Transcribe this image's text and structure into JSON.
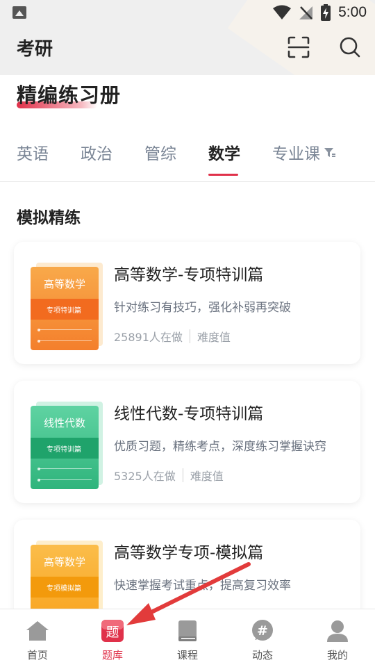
{
  "status_bar": {
    "time": "5:00"
  },
  "header": {
    "title": "考研"
  },
  "page_heading": "精编练习册",
  "tabs": [
    {
      "label": "英语",
      "active": false
    },
    {
      "label": "政治",
      "active": false
    },
    {
      "label": "管综",
      "active": false
    },
    {
      "label": "数学",
      "active": true
    },
    {
      "label": "专业课",
      "active": false
    }
  ],
  "section_title": "模拟精练",
  "cards": [
    {
      "title": "高等数学-专项特训篇",
      "description": "针对练习有技巧，强化补弱再突破",
      "participants": "25891人在做",
      "difficulty_label": "难度值",
      "cover_title": "高等数学",
      "cover_band": "专项特训篇",
      "theme": "#f7933a"
    },
    {
      "title": "线性代数-专项特训篇",
      "description": "优质习题，精练考点，深度练习掌握诀窍",
      "participants": "5325人在做",
      "difficulty_label": "难度值",
      "cover_title": "线性代数",
      "cover_band": "专项特训篇",
      "theme": "#36c08a"
    },
    {
      "title": "高等数学专项-模拟篇",
      "description": "快速掌握考试重点，提高复习效率",
      "participants": "",
      "difficulty_label": "",
      "cover_title": "高等数学",
      "cover_band": "专项模拟篇",
      "theme": "#f9a826"
    }
  ],
  "bottom_nav": [
    {
      "label": "首页",
      "icon": "home-icon",
      "active": false
    },
    {
      "label": "题库",
      "icon": "question-bank-icon",
      "glyph": "题",
      "active": true
    },
    {
      "label": "课程",
      "icon": "book-icon",
      "active": false
    },
    {
      "label": "动态",
      "icon": "hashtag-icon",
      "glyph": "#",
      "active": false
    },
    {
      "label": "我的",
      "icon": "profile-icon",
      "active": false
    }
  ],
  "colors": {
    "accent": "#e0314a",
    "orange": "#f7933a",
    "green": "#36c08a",
    "annotation": "#e23b3b"
  }
}
